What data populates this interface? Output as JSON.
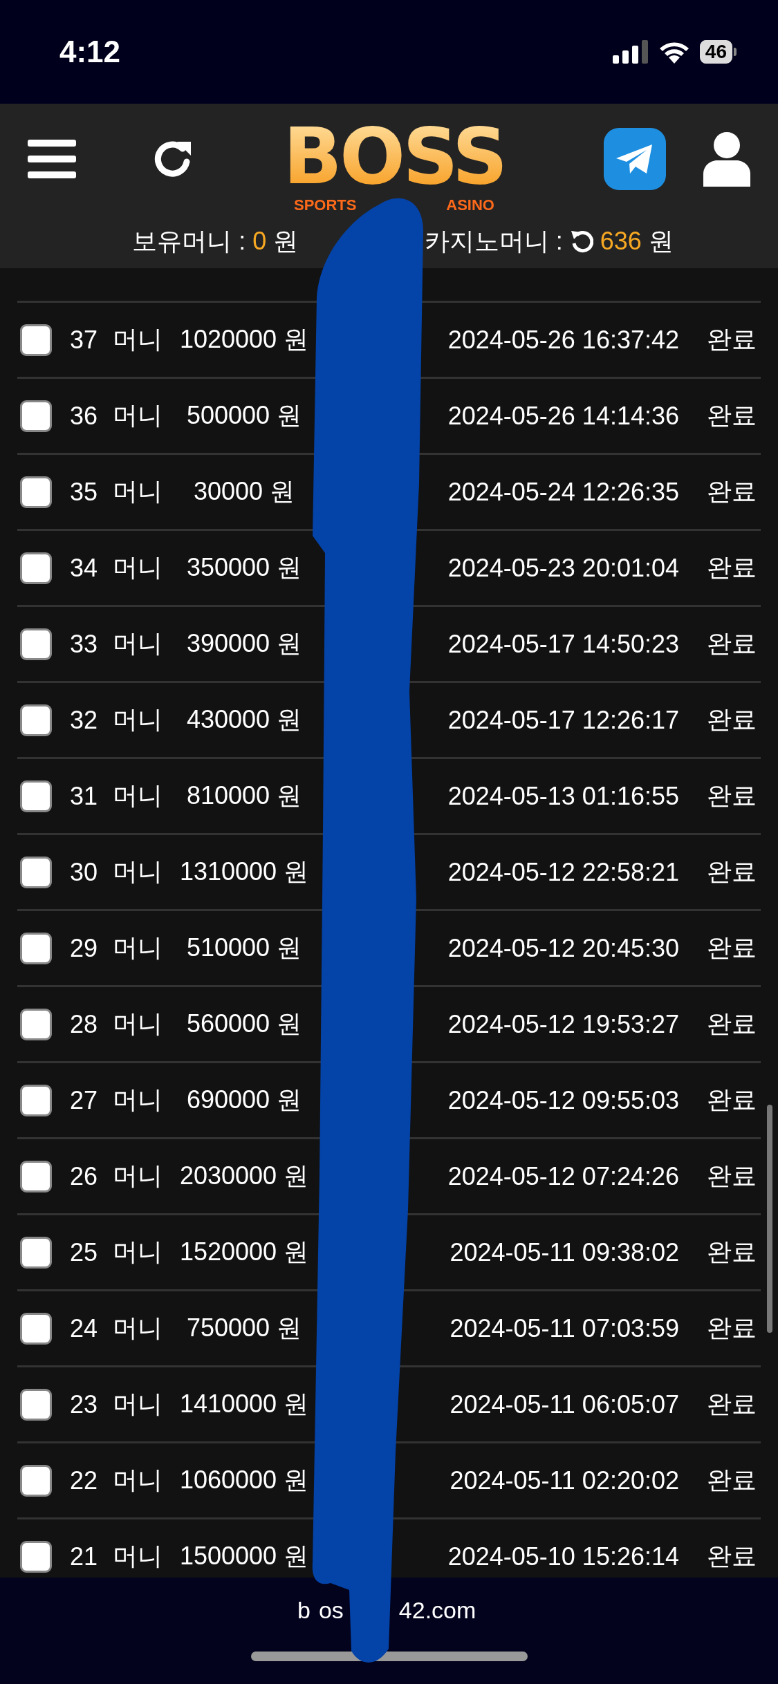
{
  "status_bar": {
    "time": "4:12",
    "battery": "46"
  },
  "header": {
    "logo": {
      "title": "BOSS",
      "subtitle_parts": [
        "SPORTS",
        "ASINO"
      ]
    },
    "balances": [
      {
        "label": "보유머니 :",
        "amount": "0",
        "unit": "원",
        "refresh": false
      },
      {
        "label": "카지노머니 :",
        "amount": "636",
        "unit": "원",
        "refresh": true
      }
    ]
  },
  "rows": [
    {
      "number": "37",
      "type": "머니",
      "amount": "1020000 원",
      "date": "2024-05-26 16:37:42",
      "status": "완료",
      "checked": false
    },
    {
      "number": "36",
      "type": "머니",
      "amount": "500000 원",
      "date": "2024-05-26 14:14:36",
      "status": "완료",
      "checked": false
    },
    {
      "number": "35",
      "type": "머니",
      "amount": "30000 원",
      "date": "2024-05-24 12:26:35",
      "status": "완료",
      "checked": false
    },
    {
      "number": "34",
      "type": "머니",
      "amount": "350000 원",
      "date": "2024-05-23 20:01:04",
      "status": "완료",
      "checked": false
    },
    {
      "number": "33",
      "type": "머니",
      "amount": "390000 원",
      "date": "2024-05-17 14:50:23",
      "status": "완료",
      "checked": false
    },
    {
      "number": "32",
      "type": "머니",
      "amount": "430000 원",
      "date": "2024-05-17 12:26:17",
      "status": "완료",
      "checked": false
    },
    {
      "number": "31",
      "type": "머니",
      "amount": "810000 원",
      "date": "2024-05-13 01:16:55",
      "status": "완료",
      "checked": false
    },
    {
      "number": "30",
      "type": "머니",
      "amount": "1310000 원",
      "date": "2024-05-12 22:58:21",
      "status": "완료",
      "checked": false
    },
    {
      "number": "29",
      "type": "머니",
      "amount": "510000 원",
      "date": "2024-05-12 20:45:30",
      "status": "완료",
      "checked": false
    },
    {
      "number": "28",
      "type": "머니",
      "amount": "560000 원",
      "date": "2024-05-12 19:53:27",
      "status": "완료",
      "checked": false
    },
    {
      "number": "27",
      "type": "머니",
      "amount": "690000 원",
      "date": "2024-05-12 09:55:03",
      "status": "완료",
      "checked": false
    },
    {
      "number": "26",
      "type": "머니",
      "amount": "2030000 원",
      "date": "2024-05-12 07:24:26",
      "status": "완료",
      "checked": false
    },
    {
      "number": "25",
      "type": "머니",
      "amount": "1520000 원",
      "date": "2024-05-11 09:38:02",
      "status": "완료",
      "checked": false
    },
    {
      "number": "24",
      "type": "머니",
      "amount": "750000 원",
      "date": "2024-05-11 07:03:59",
      "status": "완료",
      "checked": false
    },
    {
      "number": "23",
      "type": "머니",
      "amount": "1410000 원",
      "date": "2024-05-11 06:05:07",
      "status": "완료",
      "checked": false
    },
    {
      "number": "22",
      "type": "머니",
      "amount": "1060000 원",
      "date": "2024-05-11 02:20:02",
      "status": "완료",
      "checked": false
    },
    {
      "number": "21",
      "type": "머니",
      "amount": "1500000 원",
      "date": "2024-05-10 15:26:14",
      "status": "완료",
      "checked": false
    }
  ],
  "address_bar": {
    "url_parts": [
      "b",
      "os",
      "42.com"
    ]
  }
}
